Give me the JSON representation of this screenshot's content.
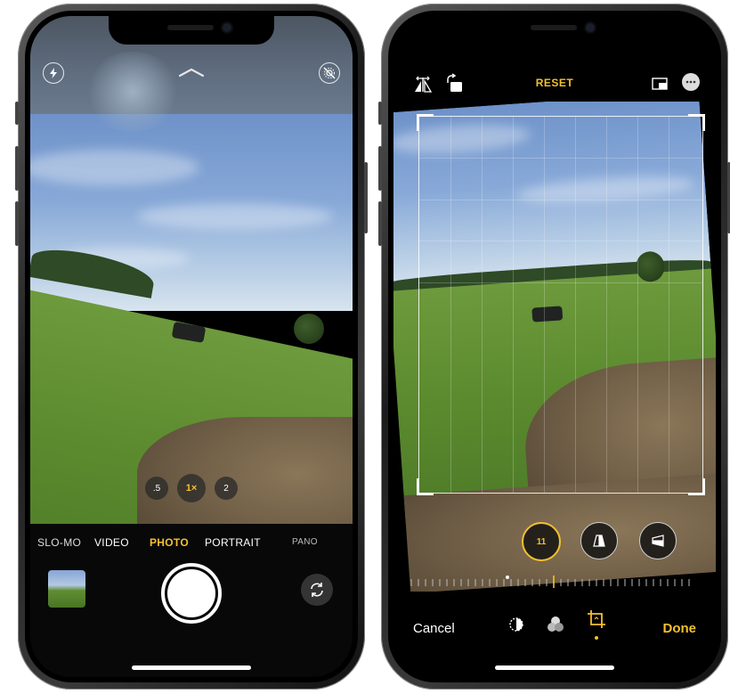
{
  "camera_screen": {
    "modes": [
      "SLO-MO",
      "VIDEO",
      "PHOTO",
      "PORTRAIT",
      "PANO"
    ],
    "active_mode": "PHOTO",
    "zoom_levels": [
      ".5",
      "1×",
      "2"
    ],
    "active_zoom": "1×",
    "icons": {
      "flash": "flash-icon",
      "chevron": "chevron-up-icon",
      "live_photo": "live-photo-off-icon",
      "shutter": "shutter-button",
      "thumbnail": "last-photo-thumbnail",
      "flip": "camera-flip-icon"
    }
  },
  "edit_screen": {
    "reset_label": "RESET",
    "cancel_label": "Cancel",
    "done_label": "Done",
    "straighten_value": "11",
    "icons": {
      "flip": "flip-horizontal-icon",
      "rotate": "rotate-icon",
      "aspect": "aspect-ratio-icon",
      "more": "more-icon",
      "straighten": "straighten-dial",
      "vertical": "vertical-perspective-icon",
      "horizontal": "horizontal-perspective-icon",
      "adjust": "adjust-icon",
      "filters": "filters-icon",
      "crop": "crop-icon"
    }
  },
  "colors": {
    "accent": "#f3c12e",
    "sky": "#7f9fd3",
    "grass": "#5b8a2e"
  }
}
